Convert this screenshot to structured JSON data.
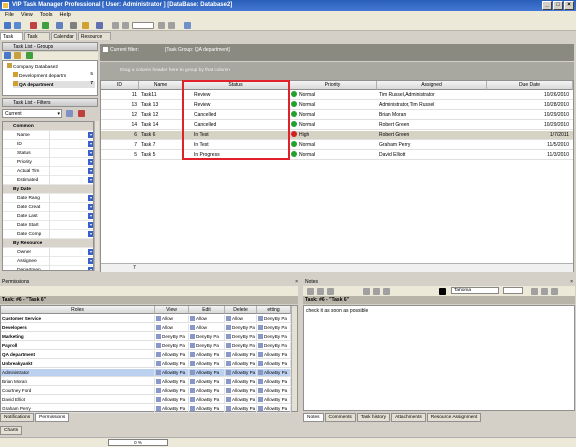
{
  "window": {
    "title": "VIP Task Manager Professional [ User: Administrator ] [DataBase: Database2]"
  },
  "menu": [
    "File",
    "View",
    "Tools",
    "Help"
  ],
  "left_tabs": [
    "Task List",
    "Task Tree",
    "Calendar",
    "Resource List"
  ],
  "groups_panel": {
    "title": "Task List - Groups",
    "tree": [
      {
        "label": "Company Database2",
        "count": ""
      },
      {
        "label": "Development departm",
        "count": "5"
      },
      {
        "label": "QA department",
        "count": "7"
      }
    ]
  },
  "filters_panel": {
    "title": "Task List - Filters",
    "current_filter": "Current",
    "categories": [
      {
        "name": "Common",
        "items": [
          "Name",
          "ID",
          "Status",
          "Priority",
          "Actual Tim",
          "Estimated"
        ]
      },
      {
        "name": "By Date",
        "items": [
          "Date Rang",
          "Date Creat",
          "Date Last",
          "Date Start",
          "Date Comp"
        ]
      },
      {
        "name": "By Resource",
        "items": [
          "Owner",
          "Assignee",
          "Departmen"
        ]
      },
      {
        "name": "Custom Fields",
        "items": []
      }
    ]
  },
  "main": {
    "current_filter_label": "Current filter:",
    "current_filter_value": "[Task Group: QA department]",
    "group_hint": "Drag a column header here to group by that column",
    "columns": [
      "ID",
      "Name",
      "Status",
      "Priority",
      "Assigned",
      "Due Date"
    ],
    "rows": [
      {
        "id": "11",
        "name": "Task11",
        "status": "Review",
        "priority": "Normal",
        "priority_color": "#22a030",
        "assigned": "Tim Russel,Administrator",
        "due": "10/26/2010",
        "selected": false
      },
      {
        "id": "13",
        "name": "Task 13",
        "status": "Review",
        "priority": "Normal",
        "priority_color": "#22a030",
        "assigned": "Administrator,Tim Russel",
        "due": "10/28/2010",
        "selected": false
      },
      {
        "id": "12",
        "name": "Task 12",
        "status": "Cancelled",
        "priority": "Normal",
        "priority_color": "#22a030",
        "assigned": "Brian Moran",
        "due": "10/29/2010",
        "selected": false
      },
      {
        "id": "14",
        "name": "Task 14",
        "status": "Cancelled",
        "priority": "Normal",
        "priority_color": "#22a030",
        "assigned": "Robert Green",
        "due": "10/29/2010",
        "selected": false
      },
      {
        "id": "6",
        "name": "Task 6",
        "status": "In Test",
        "priority": "High",
        "priority_color": "#d02020",
        "assigned": "Robert Green",
        "due": "1/7/2011",
        "selected": true
      },
      {
        "id": "7",
        "name": "Task 7",
        "status": "In Test",
        "priority": "Normal",
        "priority_color": "#22a030",
        "assigned": "Graham Perry",
        "due": "11/5/2010",
        "selected": false
      },
      {
        "id": "5",
        "name": "Task 5",
        "status": "In Progress",
        "priority": "Normal",
        "priority_color": "#22a030",
        "assigned": "David Elliott",
        "due": "11/3/2010",
        "selected": false
      }
    ],
    "footer_count": "7"
  },
  "permissions": {
    "title": "Permissions",
    "task_header": "Task: #6 - \"Task 6\"",
    "columns": [
      "Roles",
      "View",
      "Edit",
      "Delete",
      "etting permission"
    ],
    "rows": [
      {
        "role": "Customer Service",
        "bold": true,
        "view": "Allow",
        "edit": "Allow",
        "delete": "Allow",
        "perm": "DenyBy Pa"
      },
      {
        "role": "Developers",
        "bold": true,
        "view": "Allow",
        "edit": "Allow",
        "delete": "DenyBy Pa",
        "perm": "DenyBy Pa"
      },
      {
        "role": "Marketing",
        "bold": true,
        "view": "DenyBy Pa",
        "edit": "DenyBy Pa",
        "delete": "DenyBy Pa",
        "perm": "DenyBy Pa"
      },
      {
        "role": "Payroll",
        "bold": true,
        "view": "DenyBy Pa",
        "edit": "DenyBy Pa",
        "delete": "DenyBy Pa",
        "perm": "DenyBy Pa"
      },
      {
        "role": "QA department",
        "bold": true,
        "view": "AllowBy Pa",
        "edit": "AllowBy Pa",
        "delete": "AllowBy Pa",
        "perm": "AllowBy Pa"
      },
      {
        "role": "Unbreakyankt",
        "bold": true,
        "view": "AllowBy Pa",
        "edit": "AllowBy Pa",
        "delete": "AllowBy Pa",
        "perm": "AllowBy Pa"
      },
      {
        "role": "Administrator",
        "bold": false,
        "view": "AllowBy Pa",
        "edit": "AllowBy Pa",
        "delete": "AllowBy Pa",
        "perm": "AllowBy Pa",
        "selected": true
      },
      {
        "role": "Brian Moran",
        "bold": false,
        "view": "AllowBy Pa",
        "edit": "AllowBy Pa",
        "delete": "AllowBy Pa",
        "perm": "AllowBy Pa"
      },
      {
        "role": "Courtney Ford",
        "bold": false,
        "view": "AllowBy Pa",
        "edit": "AllowBy Pa",
        "delete": "AllowBy Pa",
        "perm": "AllowBy Pa"
      },
      {
        "role": "David Elliot",
        "bold": false,
        "view": "AllowBy Pa",
        "edit": "AllowBy Pa",
        "delete": "AllowBy Pa",
        "perm": "AllowBy Pa"
      },
      {
        "role": "Graham Perry",
        "bold": false,
        "view": "AllowBy Pa",
        "edit": "AllowBy Pa",
        "delete": "AllowBy Pa",
        "perm": "AllowBy Pa"
      }
    ],
    "tabs": [
      "Notifications",
      "Permissions"
    ]
  },
  "notes": {
    "title": "Notes",
    "task_header": "Task: #6 - \"Task 6\"",
    "font_name": "Tahoma",
    "text": "check it as soon as possible",
    "tabs": [
      "Notes",
      "Comments",
      "Task history",
      "Attachments",
      "Resource Assignment"
    ]
  },
  "charts_tab": "Charts",
  "status": {
    "progress": "0 %"
  }
}
